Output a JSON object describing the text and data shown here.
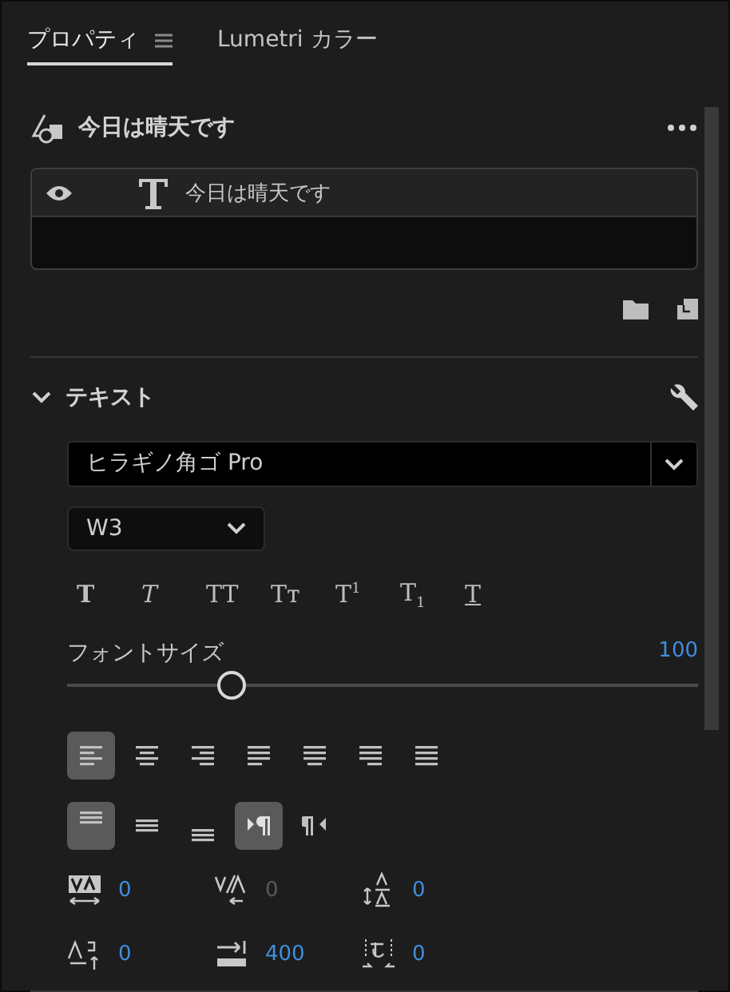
{
  "tabs": [
    {
      "label": "プロパティ",
      "selected": true,
      "menu_icon": true
    },
    {
      "label": "Lumetri カラー",
      "selected": false,
      "menu_icon": false
    }
  ],
  "clip": {
    "title": "今日は晴天です",
    "layers": [
      {
        "name": "今日は晴天です",
        "visible": true
      }
    ]
  },
  "text_section": {
    "title": "テキスト",
    "expanded": true,
    "font": "ヒラギノ角ゴ Pro",
    "weight": "W3",
    "styles": [
      {
        "label": "T",
        "kind": "bold"
      },
      {
        "label": "T",
        "kind": "italic"
      },
      {
        "label": "TT",
        "kind": "caps"
      },
      {
        "label": "Tт",
        "kind": "smallcaps"
      },
      {
        "label": "T$^{1}$",
        "kind": "super"
      },
      {
        "label": "T$_{1}$",
        "kind": "sub"
      },
      {
        "label": "T",
        "kind": "underline"
      }
    ],
    "font_size": {
      "label": "フォントサイズ",
      "value": "100",
      "level": 0.26
    },
    "alignment": [
      {
        "kind": "left",
        "selected": true
      },
      {
        "kind": "center",
        "selected": false
      },
      {
        "kind": "right",
        "selected": false
      },
      {
        "kind": "justify-left",
        "selected": false
      },
      {
        "kind": "justify-center",
        "selected": false
      },
      {
        "kind": "justify-right",
        "selected": false
      },
      {
        "kind": "justify-all",
        "selected": false
      }
    ],
    "vertical": [
      {
        "kind": "top",
        "selected": true
      },
      {
        "kind": "middle",
        "selected": false
      },
      {
        "kind": "bottom",
        "selected": false
      }
    ],
    "direction": [
      {
        "kind": "ltr",
        "selected": true
      },
      {
        "kind": "rtl",
        "selected": false
      }
    ],
    "metrics": [
      {
        "kind": "tracking",
        "value": "0",
        "disabled": false
      },
      {
        "kind": "kerning",
        "value": "0",
        "disabled": true
      },
      {
        "kind": "leading",
        "value": "0",
        "disabled": false
      },
      {
        "kind": "baseline",
        "value": "0",
        "disabled": false
      },
      {
        "kind": "tab",
        "value": "400",
        "disabled": false
      },
      {
        "kind": "tsume",
        "value": "0",
        "disabled": false
      }
    ]
  }
}
